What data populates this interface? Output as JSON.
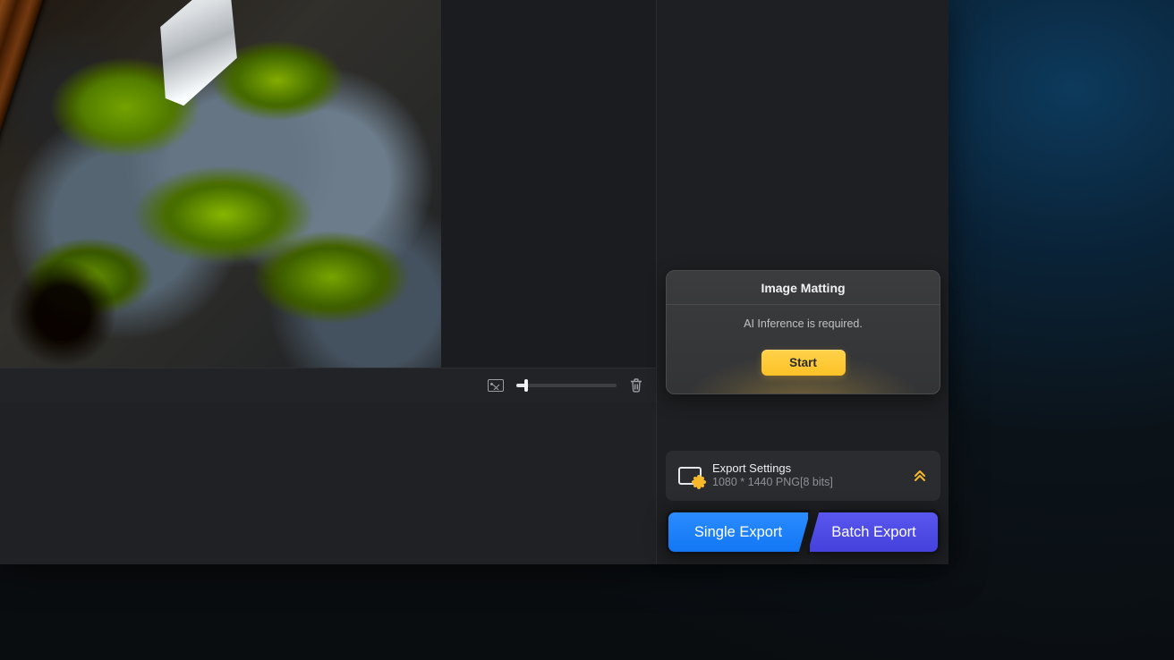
{
  "matting_panel": {
    "title": "Image Matting",
    "message": "AI Inference is required.",
    "start_label": "Start"
  },
  "export_settings": {
    "title": "Export Settings",
    "detail": "1080 * 1440 PNG[8 bits]"
  },
  "export_buttons": {
    "single": "Single Export",
    "batch": "Batch Export"
  },
  "canvas_toolbar": {
    "zoom_percent": 10
  }
}
